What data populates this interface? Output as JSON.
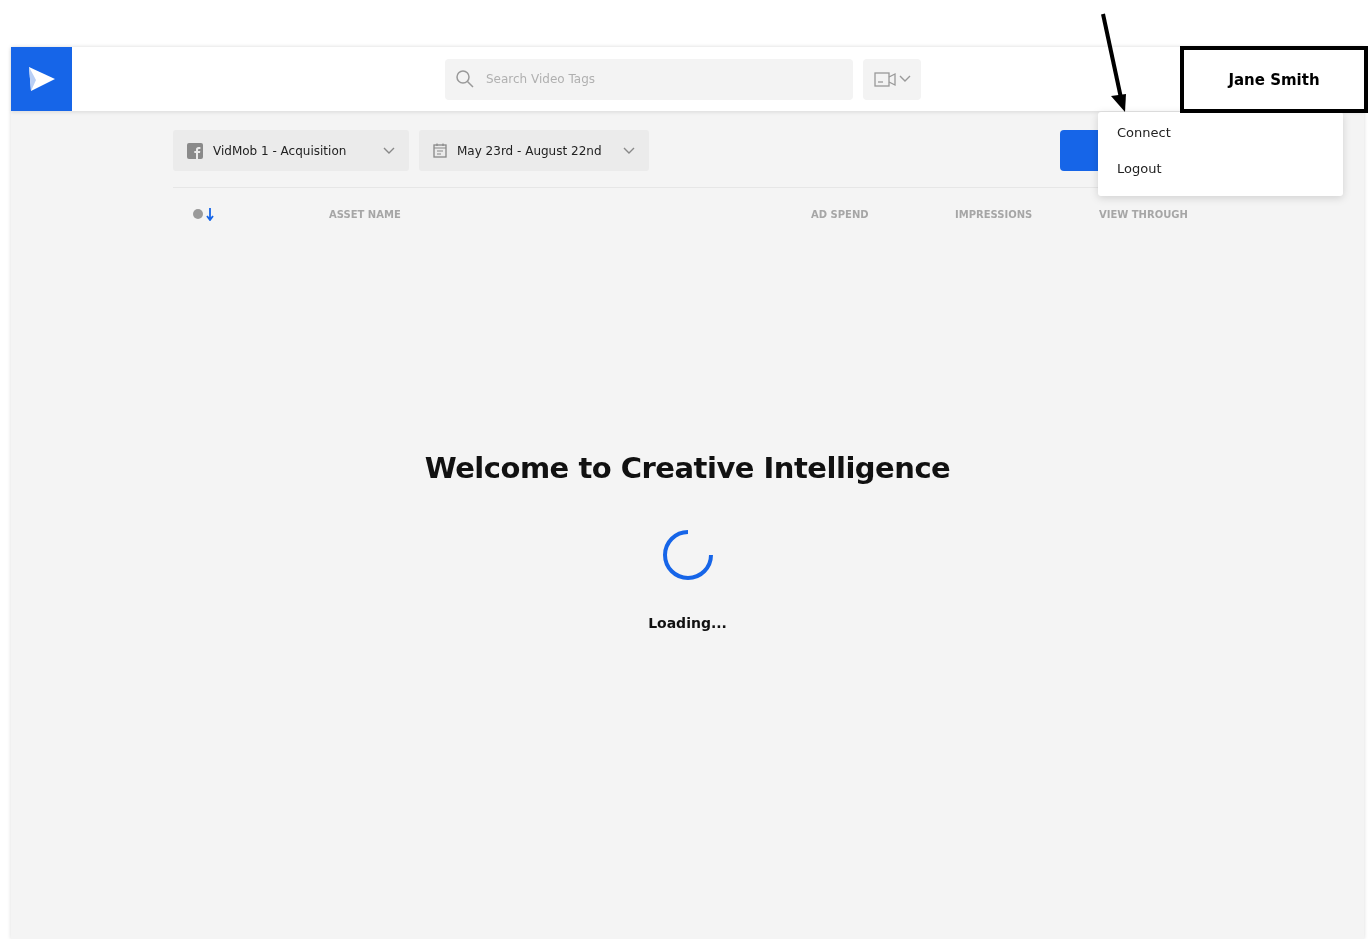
{
  "header": {
    "search": {
      "placeholder": "Search Video Tags"
    }
  },
  "user": {
    "name": "Jane Smith"
  },
  "user_menu": {
    "items": [
      "Connect",
      "Logout"
    ]
  },
  "filters": {
    "account": "VidMob 1 - Acquisition",
    "date_range": "May 23rd - August 22nd"
  },
  "table": {
    "columns": [
      "ASSET NAME",
      "AD SPEND",
      "IMPRESSIONS",
      "VIEW THROUGH"
    ]
  },
  "welcome": {
    "title": "Welcome to Creative Intelligence",
    "status": "Loading..."
  }
}
